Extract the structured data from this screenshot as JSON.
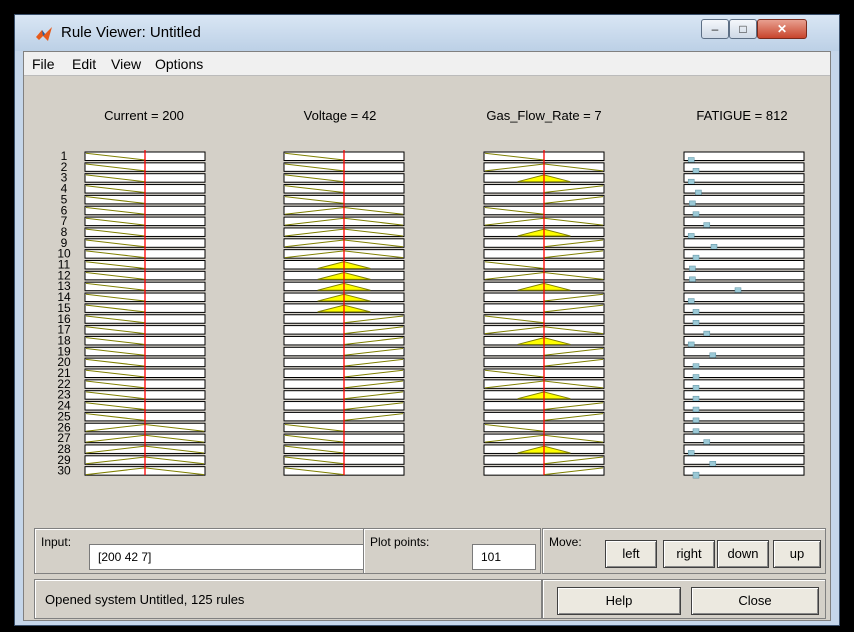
{
  "window": {
    "title": "Rule Viewer: Untitled"
  },
  "menu": {
    "items": [
      "File",
      "Edit",
      "View",
      "Options"
    ]
  },
  "variables": [
    {
      "label": "Current = 200"
    },
    {
      "label": "Voltage = 42"
    },
    {
      "label": "Gas_Flow_Rate = 7"
    },
    {
      "label": "FATIGUE = 812"
    }
  ],
  "rules": {
    "numbers": [
      "1",
      "2",
      "3",
      "4",
      "5",
      "6",
      "7",
      "8",
      "9",
      "10",
      "11",
      "12",
      "13",
      "14",
      "15",
      "16",
      "17",
      "18",
      "19",
      "20",
      "21",
      "22",
      "23",
      "24",
      "25",
      "26",
      "27",
      "28",
      "29",
      "30"
    ],
    "current_mf": [
      "L",
      "L",
      "L",
      "L",
      "L",
      "L",
      "L",
      "L",
      "L",
      "L",
      "L",
      "L",
      "L",
      "L",
      "L",
      "L",
      "L",
      "L",
      "L",
      "L",
      "L",
      "L",
      "L",
      "L",
      "L",
      "M",
      "M",
      "M",
      "M",
      "M"
    ],
    "voltage_mf": [
      "L",
      "L",
      "L",
      "L",
      "L",
      "M",
      "M",
      "M",
      "M",
      "M",
      "F",
      "F",
      "F",
      "F",
      "F",
      "H",
      "H",
      "H",
      "H",
      "H",
      "H",
      "H",
      "H",
      "H",
      "H",
      "L",
      "L",
      "L",
      "L",
      "L"
    ],
    "gas_mf": [
      "L",
      "M",
      "F",
      "H",
      "H",
      "L",
      "M",
      "F",
      "H",
      "H",
      "L",
      "M",
      "F",
      "H",
      "H",
      "L",
      "M",
      "F",
      "H",
      "H",
      "L",
      "M",
      "F",
      "H",
      "H",
      "L",
      "M",
      "F",
      "H",
      "H"
    ],
    "fatigue_marker": [
      0.06,
      0.1,
      0.06,
      0.12,
      0.07,
      0.1,
      0.19,
      0.06,
      0.25,
      0.1,
      0.07,
      0.07,
      0.45,
      0.06,
      0.1,
      0.1,
      0.19,
      0.06,
      0.24,
      0.1,
      0.1,
      0.1,
      0.1,
      0.1,
      0.1,
      0.1,
      0.19,
      0.06,
      0.24,
      0.1
    ],
    "input_lines": [
      0.5,
      0.5,
      0.5
    ],
    "colors": {
      "fill": "#ffff00",
      "edge": "#808000",
      "cursor": "#ff0000",
      "marker": "#9bc9d6"
    }
  },
  "controls": {
    "input_label": "Input:",
    "input_value": "[200 42 7]",
    "plot_points_label": "Plot points:",
    "plot_points_value": "101",
    "move_label": "Move:",
    "left": "left",
    "right": "right",
    "down": "down",
    "up": "up",
    "help": "Help",
    "close": "Close",
    "status": "Opened system Untitled, 125 rules"
  }
}
